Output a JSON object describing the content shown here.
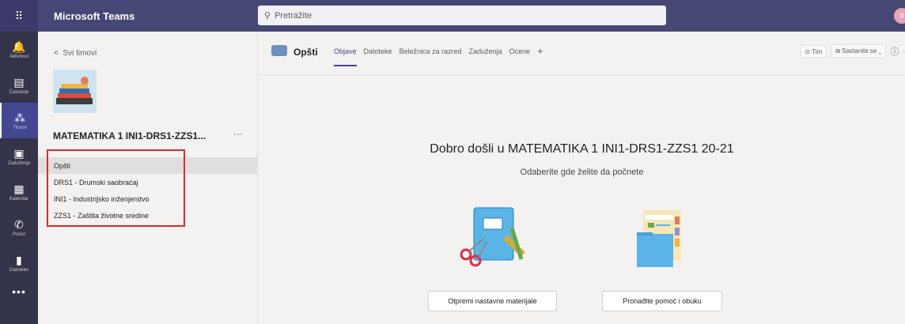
{
  "topbar": {
    "title": "Microsoft Teams",
    "search_placeholder": "Pretražite",
    "avatar_initial": "II"
  },
  "rail": [
    {
      "label": "Aktivnost",
      "icon": "bell-icon",
      "glyph": "🔔"
    },
    {
      "label": "Ćaskanje",
      "icon": "chat-icon",
      "glyph": "▤"
    },
    {
      "label": "Timovi",
      "icon": "teams-icon",
      "glyph": "⁂"
    },
    {
      "label": "Zaduženja",
      "icon": "assignments-icon",
      "glyph": "▣"
    },
    {
      "label": "Kalendar",
      "icon": "calendar-icon",
      "glyph": "▦"
    },
    {
      "label": "Pozivi",
      "icon": "phone-icon",
      "glyph": "✆"
    },
    {
      "label": "Datoteke",
      "icon": "files-icon",
      "glyph": "▮"
    }
  ],
  "rail_more": "•••",
  "panel": {
    "back_label": "Svi timovi",
    "team_name": "MATEMATIKA 1 INI1-DRS1-ZZS1...",
    "more": "···",
    "channels": [
      "Opšti",
      "DRS1 - Drumski saobraćaj",
      "INI1 - Industrijsko inženjerstvo",
      "ZZS1 - Zaštita životne sredine"
    ]
  },
  "main": {
    "channel_title": "Opšti",
    "tabs": [
      "Objave",
      "Datoteke",
      "Beležnica za razred",
      "Zaduženja",
      "Ocene"
    ],
    "add_tab": "+",
    "team_button": "Tim",
    "meet_button": "Sastanite se",
    "welcome": "Dobro došli u MATEMATIKA 1 INI1-DRS1-ZZS1 20-21",
    "subtitle": "Odaberite gde želite da počnete",
    "card1_button": "Otpremi nastavne materijale",
    "card2_button": "Pronađite pomoć i obuku"
  }
}
